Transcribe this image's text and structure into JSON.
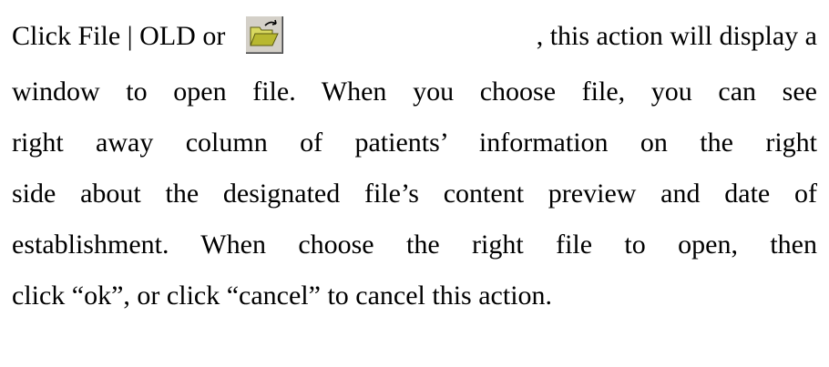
{
  "paragraph": {
    "line1": {
      "before_icon": "Click File | OLD or",
      "after_icon": ", this action will display a",
      "icon": "open-folder-icon"
    },
    "line2": "window to open file. When you choose file, you can see",
    "line3": "right away column of patients’ information on the right",
    "line4": "side about the designated file’s content preview and date of",
    "line5": "establishment. When choose the right file to open, then",
    "line6": "click “ok”, or click “cancel” to cancel this action."
  },
  "colors": {
    "folder_fill": "#b8b830",
    "folder_dark": "#6b6b10",
    "button_face": "#d4d0c8"
  }
}
